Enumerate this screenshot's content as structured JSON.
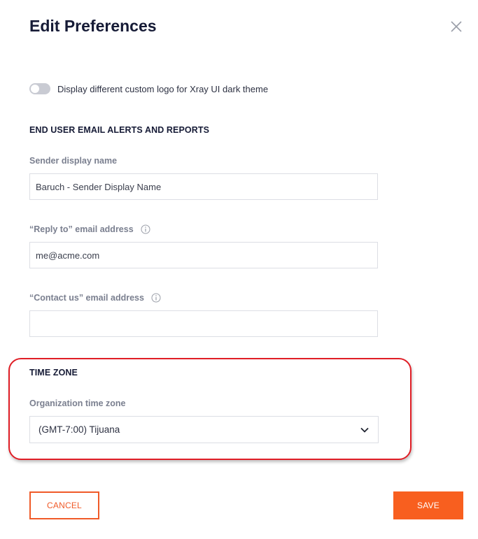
{
  "dialog": {
    "title": "Edit Preferences"
  },
  "toggle": {
    "label": "Display different custom logo for Xray UI dark theme",
    "state": "off"
  },
  "email_section": {
    "title": "END USER EMAIL ALERTS AND REPORTS",
    "sender": {
      "label": "Sender display name",
      "value": "Baruch - Sender Display Name"
    },
    "reply_to": {
      "label": "“Reply to” email address",
      "value": "me@acme.com"
    },
    "contact_us": {
      "label": "“Contact us” email address",
      "value": ""
    }
  },
  "timezone_section": {
    "title": "TIME ZONE",
    "label": "Organization time zone",
    "value": "(GMT-7:00) Tijuana"
  },
  "buttons": {
    "cancel": "CANCEL",
    "save": "SAVE"
  },
  "colors": {
    "accent": "#f85f1f",
    "highlight": "#e01e26"
  }
}
